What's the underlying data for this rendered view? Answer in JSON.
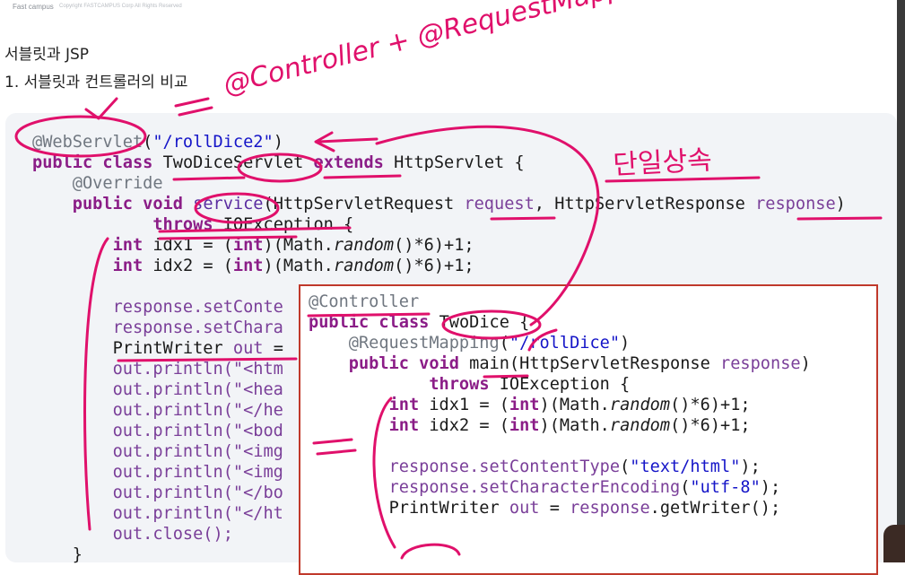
{
  "header": {
    "brand": "Fast campus",
    "copyright": "Copyright FASTCAMPUS Corp All Rights Reserved"
  },
  "slide": {
    "title": "서블릿과 JSP",
    "subtitle": "1. 서블릿과 컨트롤러의 비교"
  },
  "code_servlet": {
    "annotation": "@WebServlet",
    "path": "\"/rollDice2\"",
    "kw_public": "public",
    "kw_class": "class",
    "class_name": "TwoDiceServlet",
    "kw_extends": "extends",
    "superclass": "HttpServlet",
    "override": "@Override",
    "kw_void": "void",
    "method": "service",
    "param_type1": "HttpServletRequest",
    "param1": "request",
    "param_type2": "HttpServletResponse",
    "param2": "response",
    "kw_throws": "throws",
    "exception": "IOException",
    "kw_int": "int",
    "idx1": "idx1",
    "idx2": "idx2",
    "math_random": "random",
    "line_ct": "response.setConte",
    "line_ce": "response.setChara",
    "pw_type": "PrintWriter",
    "pw_var": "out",
    "println_1": "out.println(\"<htm",
    "println_2": "out.println(\"<hea",
    "println_3": "out.println(\"</he",
    "println_4": "out.println(\"<bod",
    "println_5": "out.println(\"<img",
    "println_6": "out.println(\"<img",
    "println_7": "out.println(\"</bo",
    "println_8": "out.println(\"</ht",
    "close": "out.close();",
    "end_brace": "}"
  },
  "code_controller": {
    "annotation": "@Controller",
    "kw_public": "public",
    "kw_class": "class",
    "class_name": "TwoDice",
    "mapping": "@RequestMapping",
    "path": "\"/rollDice\"",
    "kw_void": "void",
    "method": "main",
    "param_type": "HttpServletResponse",
    "param": "response",
    "kw_throws": "throws",
    "exception": "IOException",
    "kw_int": "int",
    "idx1": "idx1",
    "idx2": "idx2",
    "math_random": "random",
    "content_type_call": "response.setContentType",
    "content_type_arg": "\"text/html\"",
    "char_enc_call": "response.setCharacterEncoding",
    "char_enc_arg": "\"utf-8\"",
    "pw_type": "PrintWriter",
    "pw_var": "out",
    "pw_rhs": "response",
    "pw_call": ".getWriter();"
  },
  "handwriting": {
    "top_note": "@Controller + @RequestMapping",
    "single_inheritance": "단일상속"
  },
  "colors": {
    "ink": "#e0106b",
    "box_border": "#c0392b",
    "keyword": "#8b1d87",
    "string": "#1515c8",
    "annotation": "#707780"
  }
}
